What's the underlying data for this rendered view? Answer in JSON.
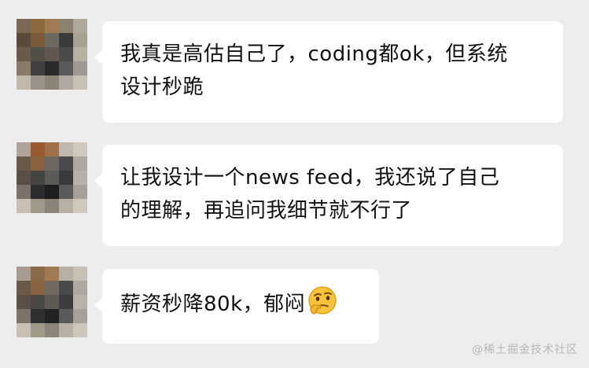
{
  "messages": [
    {
      "text": "我真是高估自己了，coding都ok，但系统设计秒跪",
      "lines": [
        "我真是高估自己了，coding都ok，但系统",
        "设计秒跪"
      ],
      "avatar_colors": [
        "#7a6a55",
        "#8b6a40",
        "#a07a50",
        "#8a8070",
        "#b0a89a",
        "#5a4a3a",
        "#7a5a38",
        "#6a6a60",
        "#3a3a38",
        "#a8a090",
        "#6a5a48",
        "#505048",
        "#605850",
        "#4a4a48",
        "#b8b0a0",
        "#8a7a68",
        "#404040",
        "#2a2a2a",
        "#5a5a58",
        "#a09890",
        "#c0b8a8",
        "#9a9288",
        "#8a8478",
        "#b0a8a0",
        "#c8c0b4"
      ]
    },
    {
      "text": "让我设计一个news feed，我还说了自己的理解，再追问我细节就不行了",
      "lines": [
        "让我设计一个news feed，我还说了自己",
        "的理解，再追问我细节就不行了"
      ],
      "avatar_colors": [
        "#b0a498",
        "#9a5a30",
        "#a07048",
        "#c0b8ac",
        "#d0c8bc",
        "#6a5a48",
        "#8a6440",
        "#6a6860",
        "#4a4a48",
        "#b0a8a0",
        "#5a5048",
        "#444440",
        "#5a5a58",
        "#3a3a3a",
        "#b8b0a8",
        "#7a7268",
        "#2c2c2c",
        "#1e1e1e",
        "#5a5a58",
        "#a8a098",
        "#c8c0b4",
        "#a09888",
        "#8a8478",
        "#b8b0a4",
        "#d0c8bc"
      ]
    },
    {
      "text": "薪资秒降80k，郁闷",
      "lines": [
        "薪资秒降80k，郁闷"
      ],
      "emoji": "thinking-face",
      "avatar_colors": [
        "#a89c90",
        "#8a6a48",
        "#a07a52",
        "#b8b0a4",
        "#c8c0b4",
        "#6a5a48",
        "#8a6440",
        "#706a60",
        "#4a4a48",
        "#b0a8a0",
        "#5a5048",
        "#484844",
        "#5e5a56",
        "#3c3c3c",
        "#bab2a8",
        "#7c7468",
        "#303030",
        "#222222",
        "#5a5a58",
        "#a8a098",
        "#c8c0b4",
        "#a09888",
        "#8c8478",
        "#b8b0a4",
        "#cec6ba"
      ]
    }
  ],
  "watermark": "@稀土掘金技术社区"
}
